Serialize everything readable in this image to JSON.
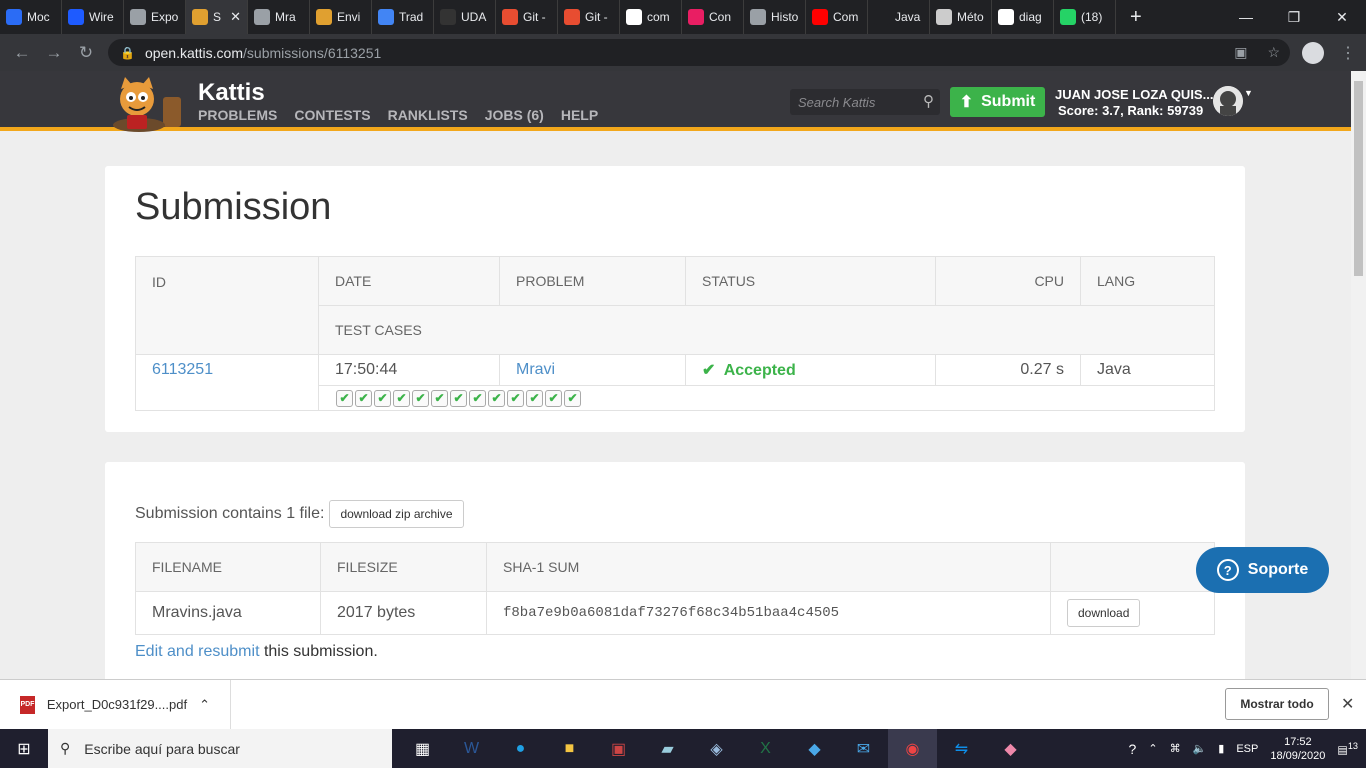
{
  "browser": {
    "tabs": [
      {
        "label": "Moc",
        "icon": "monday-icon",
        "color": "#2b6cf5"
      },
      {
        "label": "Wire",
        "icon": "wire-icon",
        "color": "#1e5bff"
      },
      {
        "label": "Expo",
        "icon": "globe-icon",
        "color": "#9aa0a6"
      },
      {
        "label": "S",
        "icon": "kattis-icon",
        "color": "#e0a030",
        "active": true
      },
      {
        "label": "Mra",
        "icon": "globe-icon",
        "color": "#9aa0a6"
      },
      {
        "label": "Envi",
        "icon": "kattis-icon",
        "color": "#e0a030"
      },
      {
        "label": "Trad",
        "icon": "translate-icon",
        "color": "#4285f4"
      },
      {
        "label": "UDA",
        "icon": "github-icon",
        "color": "#333"
      },
      {
        "label": "Git -",
        "icon": "git-icon",
        "color": "#e84d31"
      },
      {
        "label": "Git -",
        "icon": "git-icon",
        "color": "#e84d31"
      },
      {
        "label": "com",
        "icon": "google-icon",
        "color": "#fff"
      },
      {
        "label": "Con",
        "icon": "colors-icon",
        "color": "#e91e63"
      },
      {
        "label": "Histo",
        "icon": "history-icon",
        "color": "#9aa0a6"
      },
      {
        "label": "Com",
        "icon": "youtube-icon",
        "color": "#ff0000"
      },
      {
        "label": "Java",
        "icon": "java-icon",
        "color": "#202124"
      },
      {
        "label": "Méto",
        "icon": "method-icon",
        "color": "#ccc"
      },
      {
        "label": "diag",
        "icon": "google-icon",
        "color": "#fff"
      },
      {
        "label": "(18)",
        "icon": "whatsapp-icon",
        "color": "#25d366"
      }
    ],
    "url_host": "open.kattis.com",
    "url_path": "/submissions/6113251"
  },
  "kattis": {
    "brand": "Kattis",
    "nav": [
      "PROBLEMS",
      "CONTESTS",
      "RANKLISTS",
      "JOBS (6)",
      "HELP"
    ],
    "search_placeholder": "Search Kattis",
    "submit_label": "Submit",
    "user_name": "JUAN JOSE LOZA QUIS...",
    "user_score": "Score: 3.7, Rank: 59739",
    "accent_color": "#f2a71b"
  },
  "submission": {
    "title": "Submission",
    "headers": {
      "id": "ID",
      "date": "DATE",
      "problem": "PROBLEM",
      "status": "STATUS",
      "cpu": "CPU",
      "lang": "LANG",
      "test_cases": "TEST CASES"
    },
    "row": {
      "id": "6113251",
      "date": "17:50:44",
      "problem": "Mravi",
      "status": "Accepted",
      "cpu": "0.27 s",
      "lang": "Java"
    },
    "test_cases_passed": 13
  },
  "files": {
    "intro": "Submission contains 1 file:",
    "zip_button": "download zip archive",
    "headers": {
      "filename": "FILENAME",
      "filesize": "FILESIZE",
      "sha": "SHA-1 SUM"
    },
    "rows": [
      {
        "filename": "Mravins.java",
        "filesize": "2017 bytes",
        "sha": "f8ba7e9b0a6081daf73276f68c34b51baa4c4505",
        "download": "download"
      }
    ],
    "resubmit_link": "Edit and resubmit",
    "resubmit_rest": " this submission."
  },
  "support": {
    "label": "Soporte"
  },
  "downloads": {
    "file": "Export_D0c931f29....pdf",
    "show_all": "Mostrar todo"
  },
  "taskbar": {
    "search": "Escribe aquí para buscar",
    "lang": "ESP",
    "time": "17:52",
    "date": "18/09/2020",
    "notifications": "13"
  }
}
